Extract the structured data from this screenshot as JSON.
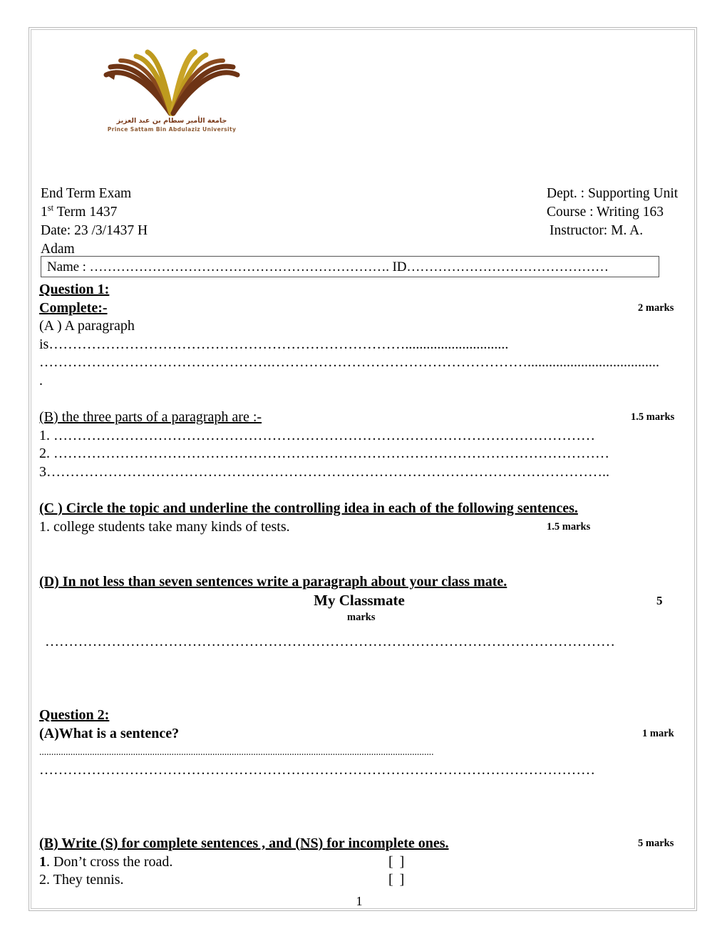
{
  "logo": {
    "arabic_name": "جامعة الأمير سطام بن عبد العزيز",
    "english_name": "Prince Sattam Bin Abdulaziz University",
    "colors": {
      "gold": "#BE9A1E",
      "brown": "#6E3415"
    }
  },
  "header": {
    "exam_title": "End Term Exam",
    "term": "1",
    "term_ordinal": "st",
    "term_rest": " Term 1437",
    "date": "Date:   23 /3/1437 H",
    "instructor_wrap": "Adam",
    "dept": "Dept. : Supporting Unit",
    "course": "Course : Writing 163",
    "instructor": "Instructor: M. A."
  },
  "name_box": {
    "text": "Name : …………………………………………………………. ID………………………………………"
  },
  "question1": {
    "title": "Question 1:",
    "instruction": "Complete:-",
    "marks": "2 marks",
    "part_a": {
      "label": "(A ) A paragraph",
      "line1": "is………………………………………………………………….............................",
      "line2": "………………………………………….……………………………………………….....................................",
      "line3": "."
    },
    "part_b": {
      "label": "(B) the three parts of a paragraph are :-",
      "marks": "1.5 marks",
      "items": [
        "1. ……………………………………………………………………………………………………",
        "2. ………………………………………………………………………………………………………",
        "3……………………………………………………………………………………………………….."
      ]
    },
    "part_c": {
      "label": " (C ) Circle the topic  and underline the controlling idea in each of the following sentences. ",
      "item1": "1. college students take many kinds of tests.",
      "marks": "1.5 marks"
    },
    "part_d": {
      "label": "(D) In not less than seven sentences write a paragraph about your class mate.",
      "topic": "My Classmate",
      "marks_number": "5",
      "marks_word": "marks",
      "answer_line": "…………………………………………………………………………………………………………"
    }
  },
  "question2": {
    "title": "Question 2:",
    "part_a": {
      "label": "(A)What is a sentence?",
      "marks": "1 mark",
      "line1": "....................................................................................................................................................................",
      "line2": "………………………………………………………………………………………………………"
    },
    "part_b": {
      "label": " (B) Write (S) for complete sentences , and (NS) for incomplete ones. ",
      "marks": "5 marks",
      "items": [
        {
          "number": "1",
          "rest": ".  Don’t cross the road.",
          "bracket": "[     ]"
        },
        {
          "number": "",
          "rest": "2. They tennis.",
          "bracket": "[     ]"
        }
      ]
    }
  },
  "footer": {
    "page_number": "1"
  }
}
